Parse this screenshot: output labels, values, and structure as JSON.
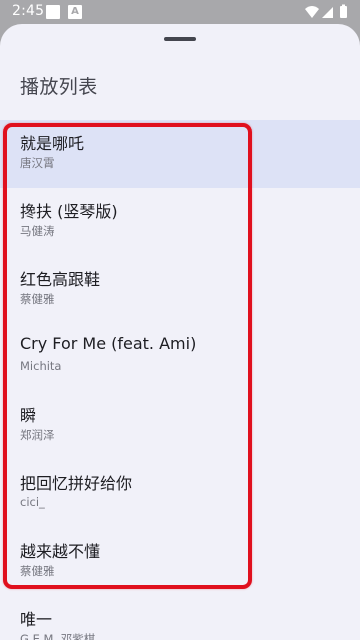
{
  "status_bar": {
    "time": "2:45",
    "notification_glyph": "A",
    "icons": [
      "notification-icon",
      "a-icon",
      "wifi-icon",
      "signal-icon",
      "battery-icon"
    ]
  },
  "sheet": {
    "title": "播放列表",
    "tracks": [
      {
        "title": "就是哪吒",
        "artist": "唐汉霄",
        "active": true
      },
      {
        "title": "搀扶 (竖琴版)",
        "artist": "马健涛",
        "active": false
      },
      {
        "title": "红色高跟鞋",
        "artist": "蔡健雅",
        "active": false
      },
      {
        "title": "Cry For Me (feat. Ami)",
        "artist": "Michita",
        "active": false
      },
      {
        "title": "瞬",
        "artist": "郑润泽",
        "active": false
      },
      {
        "title": "把回忆拼好给你",
        "artist": "cici_",
        "active": false
      },
      {
        "title": "越来越不懂",
        "artist": "蔡健雅",
        "active": false
      },
      {
        "title": "唯一",
        "artist": "G.E.M. 邓紫棋",
        "active": false
      }
    ]
  },
  "colors": {
    "sheet_background": "#f1f1f9",
    "active_row": "#dde2f6",
    "highlight": "#e0101e",
    "scrim": "#a8a8ab"
  }
}
